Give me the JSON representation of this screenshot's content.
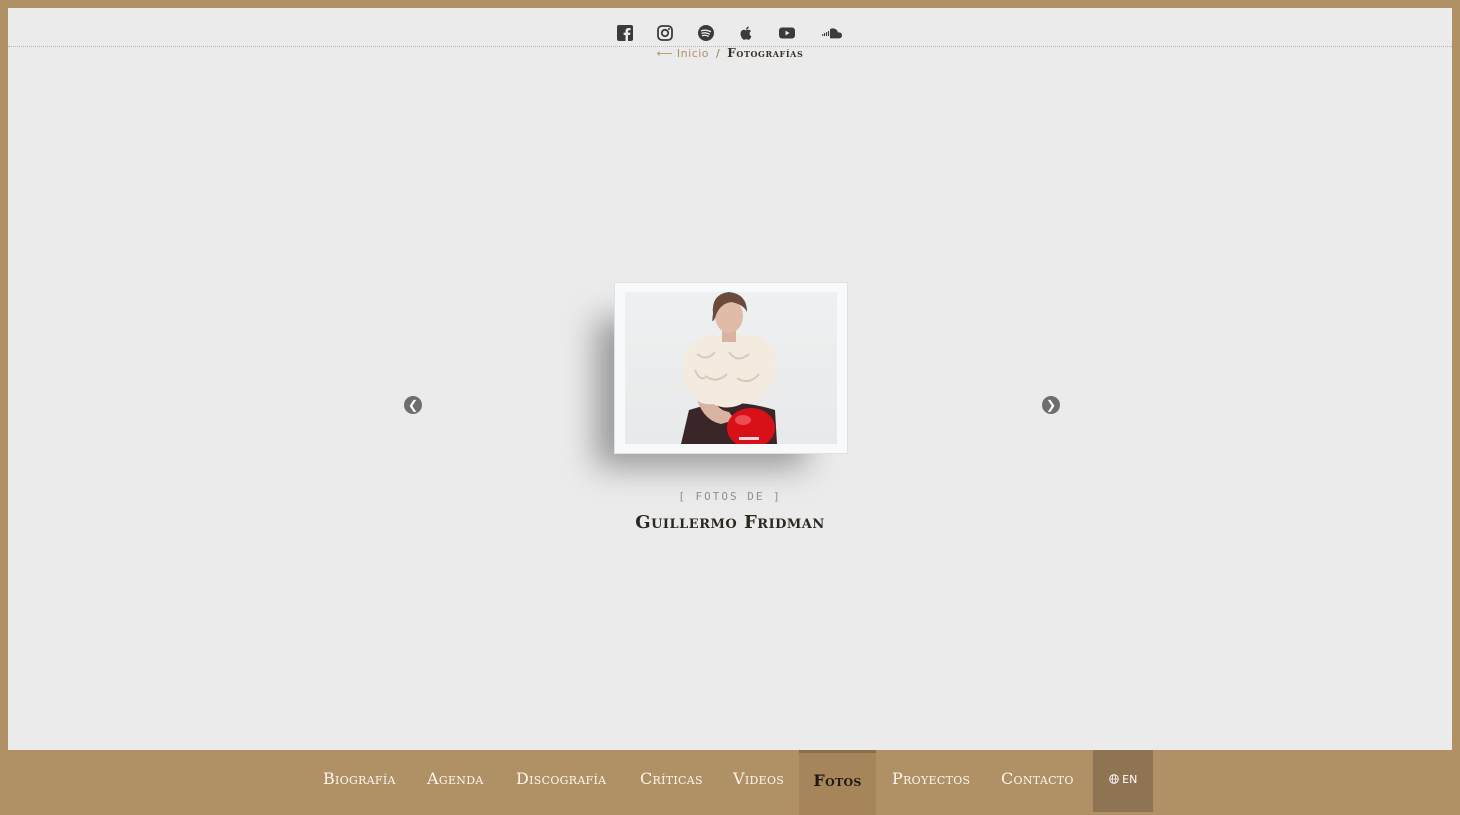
{
  "social": [
    "facebook-icon",
    "instagram-icon",
    "spotify-icon",
    "apple-icon",
    "youtube-icon",
    "soundcloud-icon"
  ],
  "breadcrumb": {
    "back_arrow": "⟵",
    "home": "Inicio",
    "separator": "/",
    "current": "Fotografías"
  },
  "gallery": {
    "prev_icon": "❮",
    "next_icon": "❯",
    "caption_small": "[ FOTOS DE ]",
    "caption_title": "Guillermo Fridman"
  },
  "nav": {
    "items": [
      "Biografía",
      "Agenda",
      "Discografía",
      "Críticas",
      "Videos",
      "Fotos",
      "Proyectos",
      "Contacto"
    ],
    "active": "Fotos",
    "lang_icon": "globe-icon",
    "lang_label": "EN"
  },
  "colors": {
    "frame": "#b09166",
    "background": "#ebebeb",
    "active_nav": "#a58559"
  }
}
